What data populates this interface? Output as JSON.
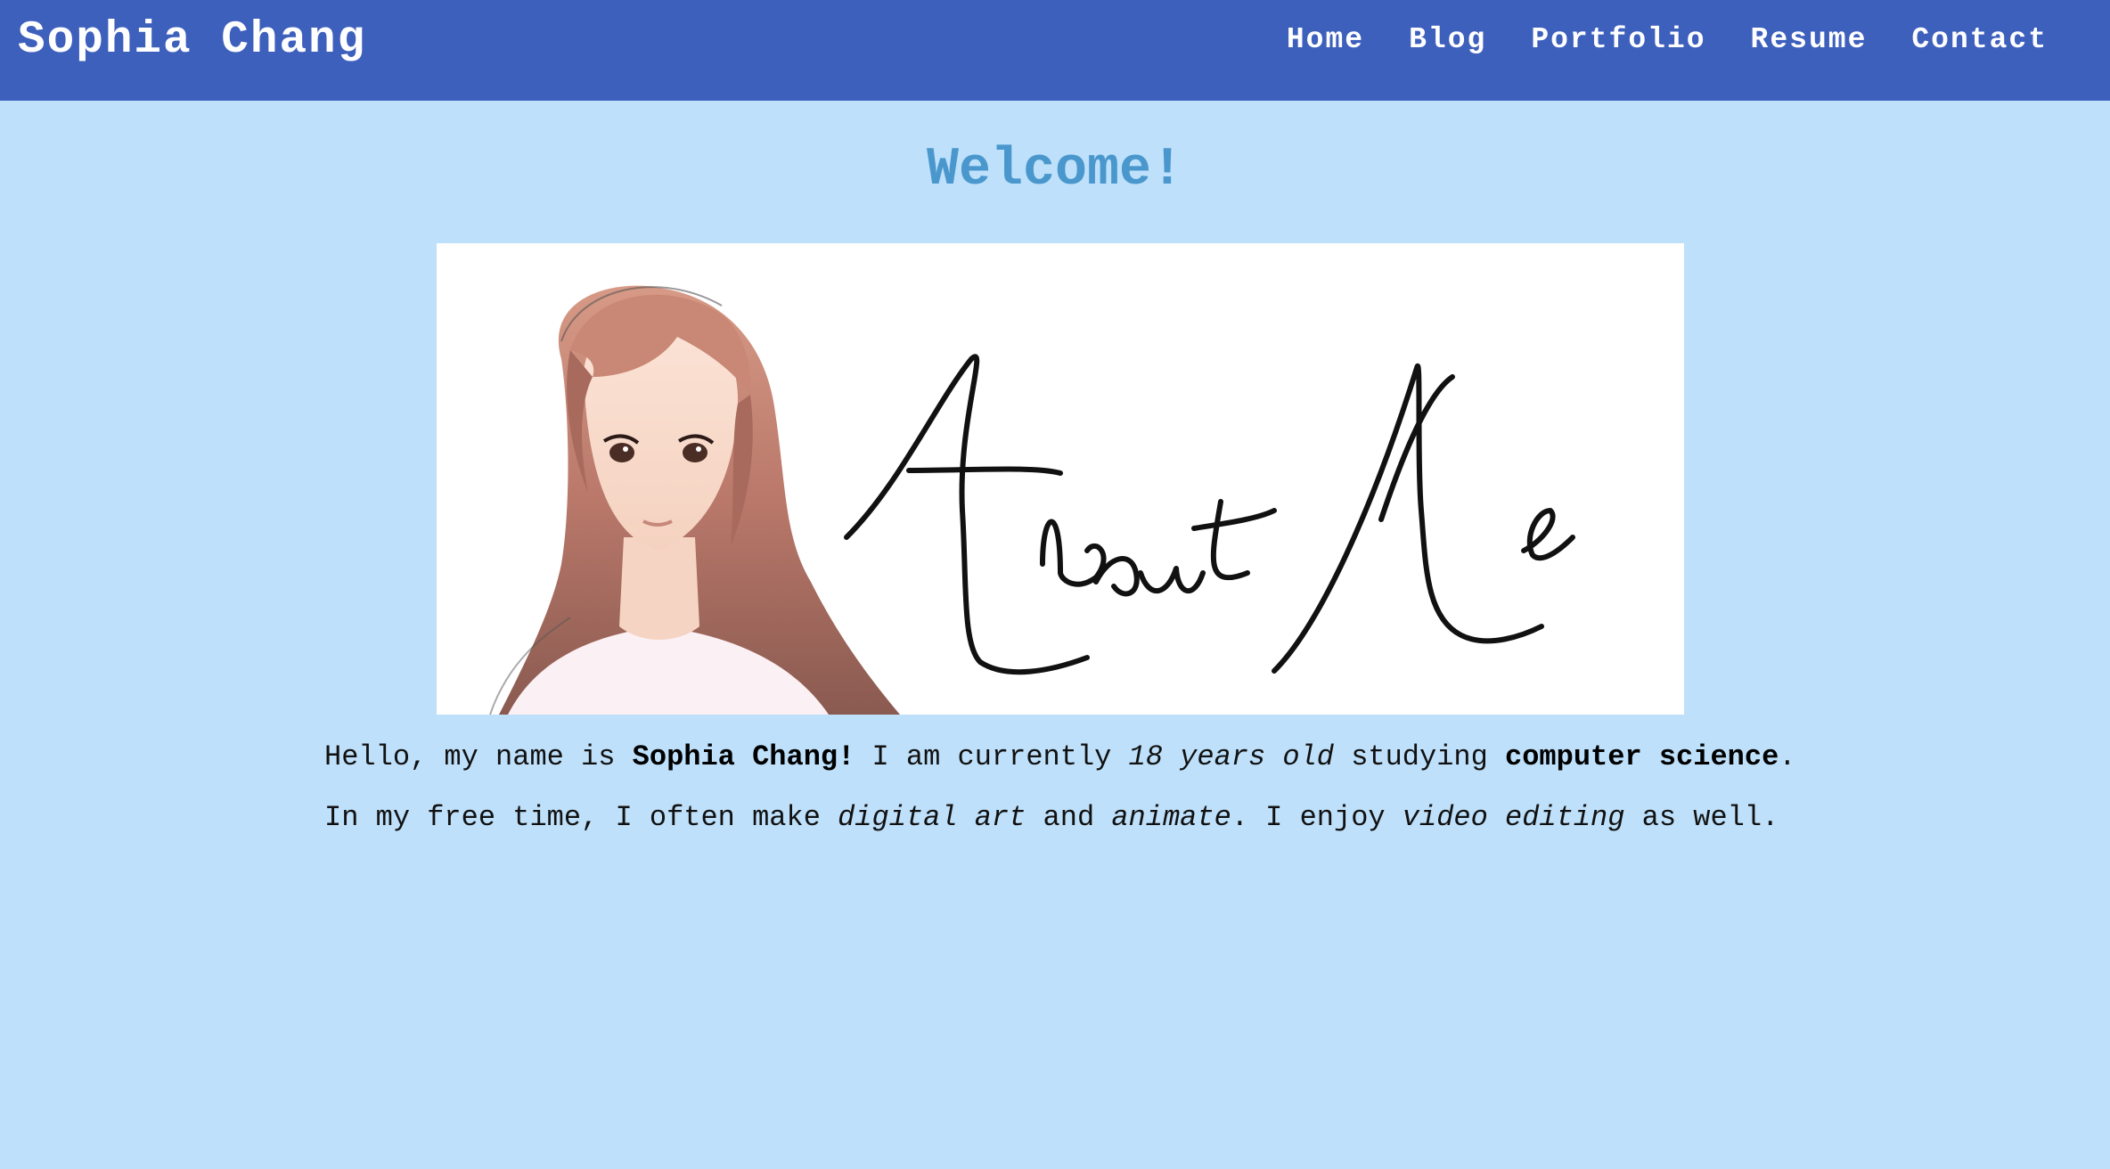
{
  "header": {
    "site_title": "Sophia Chang",
    "nav": [
      "Home",
      "Blog",
      "Portfolio",
      "Resume",
      "Contact"
    ]
  },
  "main": {
    "heading": "Welcome!",
    "banner": {
      "signature_text": "About Me"
    },
    "bio_line_1": {
      "t1": "Hello, my name is ",
      "name": "Sophia Chang!",
      "t2": " I am currently ",
      "age": "18 years old",
      "t3": " studying ",
      "field": "computer science",
      "t4": "."
    },
    "bio_line_2": {
      "t1": "In my free time, I often make ",
      "hobby1": "digital art",
      "t2": " and ",
      "hobby2": "animate",
      "t3": ". I enjoy ",
      "hobby3": "video editing",
      "t4": " as well."
    }
  },
  "colors": {
    "header_bg": "#3e60bd",
    "page_bg": "#bee0fa",
    "heading": "#4a97cd"
  }
}
